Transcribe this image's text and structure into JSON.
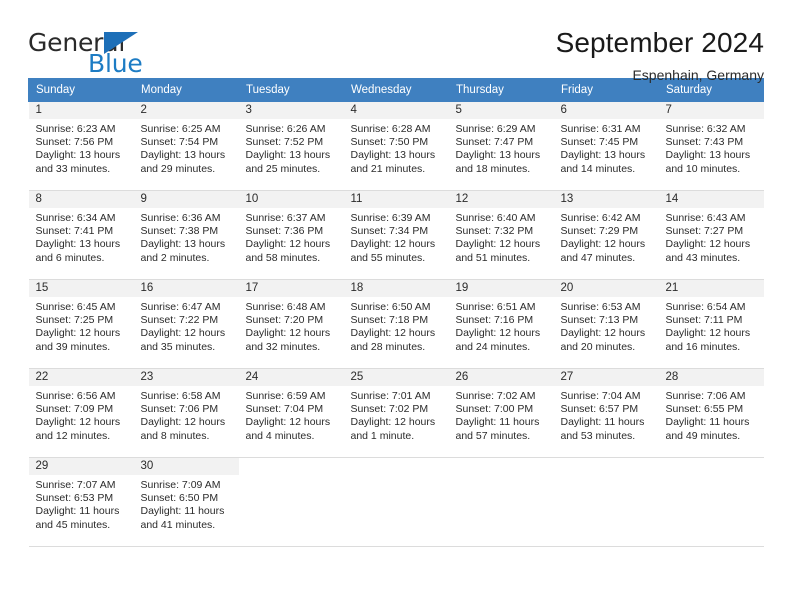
{
  "brand": {
    "name_top": "General",
    "name_bottom": "Blue",
    "triangle_icon": "blue-triangle-icon",
    "accent_color": "#1d7cc4"
  },
  "header": {
    "title": "September 2024",
    "subtitle": "Espenhain, Germany"
  },
  "calendar": {
    "header_bg": "#3f80c0",
    "daynum_bg": "#f2f2f2",
    "weekdays": [
      "Sunday",
      "Monday",
      "Tuesday",
      "Wednesday",
      "Thursday",
      "Friday",
      "Saturday"
    ],
    "weeks": [
      [
        {
          "day": "1",
          "sunrise": "Sunrise: 6:23 AM",
          "sunset": "Sunset: 7:56 PM",
          "daylight1": "Daylight: 13 hours",
          "daylight2": "and 33 minutes."
        },
        {
          "day": "2",
          "sunrise": "Sunrise: 6:25 AM",
          "sunset": "Sunset: 7:54 PM",
          "daylight1": "Daylight: 13 hours",
          "daylight2": "and 29 minutes."
        },
        {
          "day": "3",
          "sunrise": "Sunrise: 6:26 AM",
          "sunset": "Sunset: 7:52 PM",
          "daylight1": "Daylight: 13 hours",
          "daylight2": "and 25 minutes."
        },
        {
          "day": "4",
          "sunrise": "Sunrise: 6:28 AM",
          "sunset": "Sunset: 7:50 PM",
          "daylight1": "Daylight: 13 hours",
          "daylight2": "and 21 minutes."
        },
        {
          "day": "5",
          "sunrise": "Sunrise: 6:29 AM",
          "sunset": "Sunset: 7:47 PM",
          "daylight1": "Daylight: 13 hours",
          "daylight2": "and 18 minutes."
        },
        {
          "day": "6",
          "sunrise": "Sunrise: 6:31 AM",
          "sunset": "Sunset: 7:45 PM",
          "daylight1": "Daylight: 13 hours",
          "daylight2": "and 14 minutes."
        },
        {
          "day": "7",
          "sunrise": "Sunrise: 6:32 AM",
          "sunset": "Sunset: 7:43 PM",
          "daylight1": "Daylight: 13 hours",
          "daylight2": "and 10 minutes."
        }
      ],
      [
        {
          "day": "8",
          "sunrise": "Sunrise: 6:34 AM",
          "sunset": "Sunset: 7:41 PM",
          "daylight1": "Daylight: 13 hours",
          "daylight2": "and 6 minutes."
        },
        {
          "day": "9",
          "sunrise": "Sunrise: 6:36 AM",
          "sunset": "Sunset: 7:38 PM",
          "daylight1": "Daylight: 13 hours",
          "daylight2": "and 2 minutes."
        },
        {
          "day": "10",
          "sunrise": "Sunrise: 6:37 AM",
          "sunset": "Sunset: 7:36 PM",
          "daylight1": "Daylight: 12 hours",
          "daylight2": "and 58 minutes."
        },
        {
          "day": "11",
          "sunrise": "Sunrise: 6:39 AM",
          "sunset": "Sunset: 7:34 PM",
          "daylight1": "Daylight: 12 hours",
          "daylight2": "and 55 minutes."
        },
        {
          "day": "12",
          "sunrise": "Sunrise: 6:40 AM",
          "sunset": "Sunset: 7:32 PM",
          "daylight1": "Daylight: 12 hours",
          "daylight2": "and 51 minutes."
        },
        {
          "day": "13",
          "sunrise": "Sunrise: 6:42 AM",
          "sunset": "Sunset: 7:29 PM",
          "daylight1": "Daylight: 12 hours",
          "daylight2": "and 47 minutes."
        },
        {
          "day": "14",
          "sunrise": "Sunrise: 6:43 AM",
          "sunset": "Sunset: 7:27 PM",
          "daylight1": "Daylight: 12 hours",
          "daylight2": "and 43 minutes."
        }
      ],
      [
        {
          "day": "15",
          "sunrise": "Sunrise: 6:45 AM",
          "sunset": "Sunset: 7:25 PM",
          "daylight1": "Daylight: 12 hours",
          "daylight2": "and 39 minutes."
        },
        {
          "day": "16",
          "sunrise": "Sunrise: 6:47 AM",
          "sunset": "Sunset: 7:22 PM",
          "daylight1": "Daylight: 12 hours",
          "daylight2": "and 35 minutes."
        },
        {
          "day": "17",
          "sunrise": "Sunrise: 6:48 AM",
          "sunset": "Sunset: 7:20 PM",
          "daylight1": "Daylight: 12 hours",
          "daylight2": "and 32 minutes."
        },
        {
          "day": "18",
          "sunrise": "Sunrise: 6:50 AM",
          "sunset": "Sunset: 7:18 PM",
          "daylight1": "Daylight: 12 hours",
          "daylight2": "and 28 minutes."
        },
        {
          "day": "19",
          "sunrise": "Sunrise: 6:51 AM",
          "sunset": "Sunset: 7:16 PM",
          "daylight1": "Daylight: 12 hours",
          "daylight2": "and 24 minutes."
        },
        {
          "day": "20",
          "sunrise": "Sunrise: 6:53 AM",
          "sunset": "Sunset: 7:13 PM",
          "daylight1": "Daylight: 12 hours",
          "daylight2": "and 20 minutes."
        },
        {
          "day": "21",
          "sunrise": "Sunrise: 6:54 AM",
          "sunset": "Sunset: 7:11 PM",
          "daylight1": "Daylight: 12 hours",
          "daylight2": "and 16 minutes."
        }
      ],
      [
        {
          "day": "22",
          "sunrise": "Sunrise: 6:56 AM",
          "sunset": "Sunset: 7:09 PM",
          "daylight1": "Daylight: 12 hours",
          "daylight2": "and 12 minutes."
        },
        {
          "day": "23",
          "sunrise": "Sunrise: 6:58 AM",
          "sunset": "Sunset: 7:06 PM",
          "daylight1": "Daylight: 12 hours",
          "daylight2": "and 8 minutes."
        },
        {
          "day": "24",
          "sunrise": "Sunrise: 6:59 AM",
          "sunset": "Sunset: 7:04 PM",
          "daylight1": "Daylight: 12 hours",
          "daylight2": "and 4 minutes."
        },
        {
          "day": "25",
          "sunrise": "Sunrise: 7:01 AM",
          "sunset": "Sunset: 7:02 PM",
          "daylight1": "Daylight: 12 hours",
          "daylight2": "and 1 minute."
        },
        {
          "day": "26",
          "sunrise": "Sunrise: 7:02 AM",
          "sunset": "Sunset: 7:00 PM",
          "daylight1": "Daylight: 11 hours",
          "daylight2": "and 57 minutes."
        },
        {
          "day": "27",
          "sunrise": "Sunrise: 7:04 AM",
          "sunset": "Sunset: 6:57 PM",
          "daylight1": "Daylight: 11 hours",
          "daylight2": "and 53 minutes."
        },
        {
          "day": "28",
          "sunrise": "Sunrise: 7:06 AM",
          "sunset": "Sunset: 6:55 PM",
          "daylight1": "Daylight: 11 hours",
          "daylight2": "and 49 minutes."
        }
      ],
      [
        {
          "day": "29",
          "sunrise": "Sunrise: 7:07 AM",
          "sunset": "Sunset: 6:53 PM",
          "daylight1": "Daylight: 11 hours",
          "daylight2": "and 45 minutes."
        },
        {
          "day": "30",
          "sunrise": "Sunrise: 7:09 AM",
          "sunset": "Sunset: 6:50 PM",
          "daylight1": "Daylight: 11 hours",
          "daylight2": "and 41 minutes."
        },
        {
          "day": "",
          "sunrise": "",
          "sunset": "",
          "daylight1": "",
          "daylight2": ""
        },
        {
          "day": "",
          "sunrise": "",
          "sunset": "",
          "daylight1": "",
          "daylight2": ""
        },
        {
          "day": "",
          "sunrise": "",
          "sunset": "",
          "daylight1": "",
          "daylight2": ""
        },
        {
          "day": "",
          "sunrise": "",
          "sunset": "",
          "daylight1": "",
          "daylight2": ""
        },
        {
          "day": "",
          "sunrise": "",
          "sunset": "",
          "daylight1": "",
          "daylight2": ""
        }
      ]
    ]
  }
}
